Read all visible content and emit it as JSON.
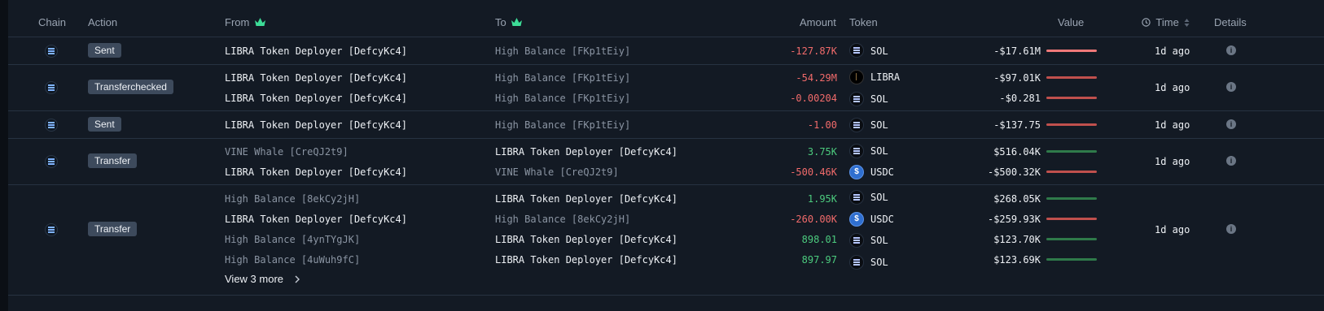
{
  "header": {
    "chain": "Chain",
    "action": "Action",
    "from": "From",
    "to": "To",
    "amount": "Amount",
    "token": "Token",
    "value": "Value",
    "time": "Time",
    "details": "Details"
  },
  "crown_icon_color": "#3ddc97",
  "rows": [
    {
      "action": "Sent",
      "time": "1d ago",
      "transfers": [
        {
          "from": "LIBRA Token Deployer [DefcyKc4]",
          "to": "High Balance [FKp1tEiy]",
          "amount": "-127.87K",
          "token": "SOL",
          "value": "-$17.61M"
        }
      ]
    },
    {
      "action": "Transferchecked",
      "time": "1d ago",
      "transfers": [
        {
          "from": "LIBRA Token Deployer [DefcyKc4]",
          "to": "High Balance [FKp1tEiy]",
          "amount": "-54.29M",
          "token": "LIBRA",
          "value": "-$97.01K"
        },
        {
          "from": "LIBRA Token Deployer [DefcyKc4]",
          "to": "High Balance [FKp1tEiy]",
          "amount": "-0.00204",
          "token": "SOL",
          "value": "-$0.281"
        }
      ]
    },
    {
      "action": "Sent",
      "time": "1d ago",
      "transfers": [
        {
          "from": "LIBRA Token Deployer [DefcyKc4]",
          "to": "High Balance [FKp1tEiy]",
          "amount": "-1.00",
          "token": "SOL",
          "value": "-$137.75"
        }
      ]
    },
    {
      "action": "Transfer",
      "time": "1d ago",
      "transfers": [
        {
          "from": "VINE Whale [CreQJ2t9]",
          "to": "LIBRA Token Deployer [DefcyKc4]",
          "amount": "3.75K",
          "token": "SOL",
          "value": "$516.04K"
        },
        {
          "from": "LIBRA Token Deployer [DefcyKc4]",
          "to": "VINE Whale [CreQJ2t9]",
          "amount": "-500.46K",
          "token": "USDC",
          "value": "-$500.32K"
        }
      ]
    },
    {
      "action": "Transfer",
      "time": "1d ago",
      "transfers": [
        {
          "from": "High Balance [8ekCy2jH]",
          "to": "LIBRA Token Deployer [DefcyKc4]",
          "amount": "1.95K",
          "token": "SOL",
          "value": "$268.05K"
        },
        {
          "from": "LIBRA Token Deployer [DefcyKc4]",
          "to": "High Balance [8ekCy2jH]",
          "amount": "-260.00K",
          "token": "USDC",
          "value": "-$259.93K"
        },
        {
          "from": "High Balance [4ynTYgJK]",
          "to": "LIBRA Token Deployer [DefcyKc4]",
          "amount": "898.01",
          "token": "SOL",
          "value": "$123.70K"
        },
        {
          "from": "High Balance [4uWuh9fC]",
          "to": "LIBRA Token Deployer [DefcyKc4]",
          "amount": "897.97",
          "token": "SOL",
          "value": "$123.69K"
        }
      ],
      "view_more": "View 3 more"
    }
  ]
}
